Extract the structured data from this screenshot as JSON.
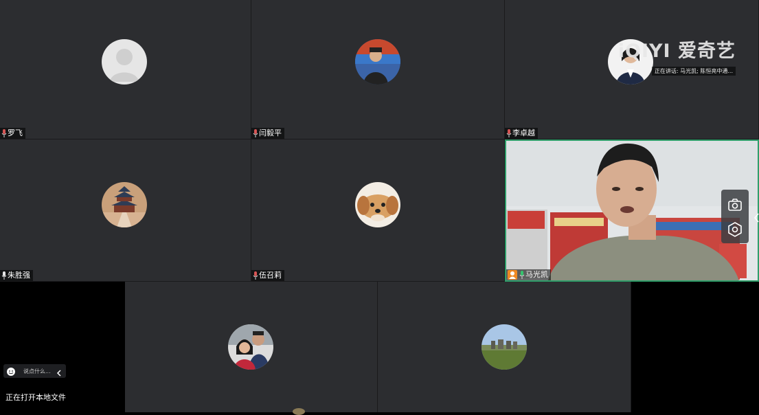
{
  "watermark": {
    "logo": "iQIYI 爱奇艺",
    "speaking": "正在讲话: 马光凯; 陈恒亮中通..."
  },
  "participants": [
    {
      "name": "罗飞",
      "avatar": "default-avatar",
      "mic": "muted"
    },
    {
      "name": "闫毅平",
      "avatar": "person-photo",
      "mic": "muted"
    },
    {
      "name": "李卓越",
      "avatar": "person-photo",
      "mic": "muted"
    },
    {
      "name": "朱胜强",
      "avatar": "temple-photo",
      "mic": "on"
    },
    {
      "name": "伍召莉",
      "avatar": "dog-photo",
      "mic": "muted"
    },
    {
      "name": "马光凯",
      "avatar": "live-video",
      "mic": "on",
      "host": true
    },
    {
      "name": "",
      "avatar": "family-photo",
      "mic": ""
    },
    {
      "name": "",
      "avatar": "landscape-photo",
      "mic": ""
    }
  ],
  "chat": {
    "placeholder": "说点什么...",
    "status": "正在打开本地文件"
  },
  "icons": {
    "camera": "camera-icon",
    "settings": "hexagon-settings-icon",
    "emoji": "emoji-icon",
    "collapse": "chevron-left-icon"
  },
  "colors": {
    "tile_bg": "#2c2d30",
    "active_border": "#2f9e6a",
    "host_badge": "#f08a24"
  }
}
